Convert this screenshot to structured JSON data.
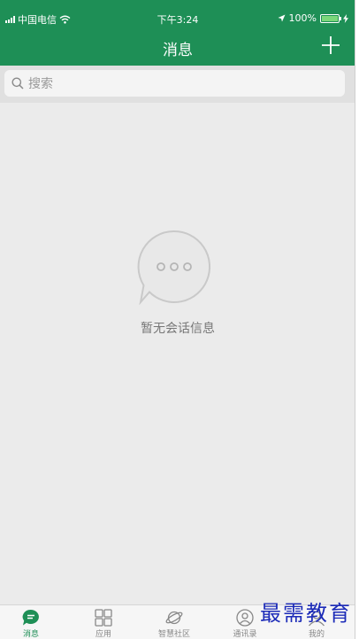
{
  "status_bar": {
    "carrier": "中国电信",
    "time": "下午3:24",
    "battery_text": "100%",
    "battery_level": 1.0
  },
  "navbar": {
    "title": "消息",
    "add_icon": "plus-icon"
  },
  "search": {
    "placeholder": "搜索",
    "icon": "search-icon"
  },
  "empty_state": {
    "icon": "chat-bubble-ellipsis-icon",
    "text": "暂无会话信息"
  },
  "tabbar": {
    "active_index": 0,
    "accent_color": "#1e8f56",
    "items": [
      {
        "label": "消息",
        "icon": "chat-bubble-icon"
      },
      {
        "label": "应用",
        "icon": "apps-grid-icon"
      },
      {
        "label": "智慧社区",
        "icon": "planet-icon"
      },
      {
        "label": "通讯录",
        "icon": "contacts-icon"
      },
      {
        "label": "我的",
        "icon": "profile-icon"
      }
    ]
  },
  "watermark": "最需教育",
  "colors": {
    "header_green": "#1e8f56",
    "background": "#ebebeb",
    "watermark_blue": "#1c2bb8"
  }
}
